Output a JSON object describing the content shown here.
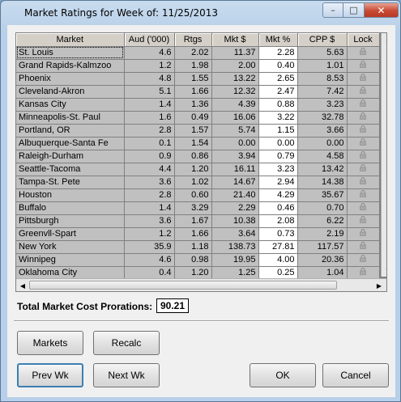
{
  "window": {
    "title": "Market Ratings for Week of: 11/25/2013",
    "minimize": "–",
    "maximize": "□",
    "close": "✕"
  },
  "grid": {
    "columns": [
      "Market",
      "Aud ('000)",
      "Rtgs",
      "Mkt $",
      "Mkt %",
      "CPP $",
      "Lock"
    ],
    "rows": [
      {
        "market": "St. Louis",
        "aud": "4.6",
        "rtgs": "2.02",
        "mkt": "11.37",
        "mktp": "2.28",
        "cpp": "5.63"
      },
      {
        "market": "Grand Rapids-Kalmzoo",
        "aud": "1.2",
        "rtgs": "1.98",
        "mkt": "2.00",
        "mktp": "0.40",
        "cpp": "1.01"
      },
      {
        "market": "Phoenix",
        "aud": "4.8",
        "rtgs": "1.55",
        "mkt": "13.22",
        "mktp": "2.65",
        "cpp": "8.53"
      },
      {
        "market": "Cleveland-Akron",
        "aud": "5.1",
        "rtgs": "1.66",
        "mkt": "12.32",
        "mktp": "2.47",
        "cpp": "7.42"
      },
      {
        "market": "Kansas City",
        "aud": "1.4",
        "rtgs": "1.36",
        "mkt": "4.39",
        "mktp": "0.88",
        "cpp": "3.23"
      },
      {
        "market": "Minneapolis-St. Paul",
        "aud": "1.6",
        "rtgs": "0.49",
        "mkt": "16.06",
        "mktp": "3.22",
        "cpp": "32.78"
      },
      {
        "market": "Portland, OR",
        "aud": "2.8",
        "rtgs": "1.57",
        "mkt": "5.74",
        "mktp": "1.15",
        "cpp": "3.66"
      },
      {
        "market": "Albuquerque-Santa Fe",
        "aud": "0.1",
        "rtgs": "1.54",
        "mkt": "0.00",
        "mktp": "0.00",
        "cpp": "0.00"
      },
      {
        "market": "Raleigh-Durham",
        "aud": "0.9",
        "rtgs": "0.86",
        "mkt": "3.94",
        "mktp": "0.79",
        "cpp": "4.58"
      },
      {
        "market": "Seattle-Tacoma",
        "aud": "4.4",
        "rtgs": "1.20",
        "mkt": "16.11",
        "mktp": "3.23",
        "cpp": "13.42"
      },
      {
        "market": "Tampa-St. Pete",
        "aud": "3.6",
        "rtgs": "1.02",
        "mkt": "14.67",
        "mktp": "2.94",
        "cpp": "14.38"
      },
      {
        "market": "Houston",
        "aud": "2.8",
        "rtgs": "0.60",
        "mkt": "21.40",
        "mktp": "4.29",
        "cpp": "35.67"
      },
      {
        "market": "Buffalo",
        "aud": "1.4",
        "rtgs": "3.29",
        "mkt": "2.29",
        "mktp": "0.46",
        "cpp": "0.70"
      },
      {
        "market": "Pittsburgh",
        "aud": "3.6",
        "rtgs": "1.67",
        "mkt": "10.38",
        "mktp": "2.08",
        "cpp": "6.22"
      },
      {
        "market": "Greenvll-Spart",
        "aud": "1.2",
        "rtgs": "1.66",
        "mkt": "3.64",
        "mktp": "0.73",
        "cpp": "2.19"
      },
      {
        "market": "New York",
        "aud": "35.9",
        "rtgs": "1.18",
        "mkt": "138.73",
        "mktp": "27.81",
        "cpp": "117.57"
      },
      {
        "market": "Winnipeg",
        "aud": "4.6",
        "rtgs": "0.98",
        "mkt": "19.95",
        "mktp": "4.00",
        "cpp": "20.36"
      },
      {
        "market": "Oklahoma City",
        "aud": "0.4",
        "rtgs": "1.20",
        "mkt": "1.25",
        "mktp": "0.25",
        "cpp": "1.04"
      }
    ],
    "lock_icon": "lock-icon",
    "scroll_up": "▲",
    "scroll_down": "▼",
    "scroll_left": "◀",
    "scroll_right": "▶"
  },
  "totals": {
    "label": "Total Market Cost Prorations:",
    "value": "90.21"
  },
  "buttons": {
    "markets": "Markets",
    "recalc": "Recalc",
    "prev_wk": "Prev Wk",
    "next_wk": "Next Wk",
    "ok": "OK",
    "cancel": "Cancel"
  }
}
